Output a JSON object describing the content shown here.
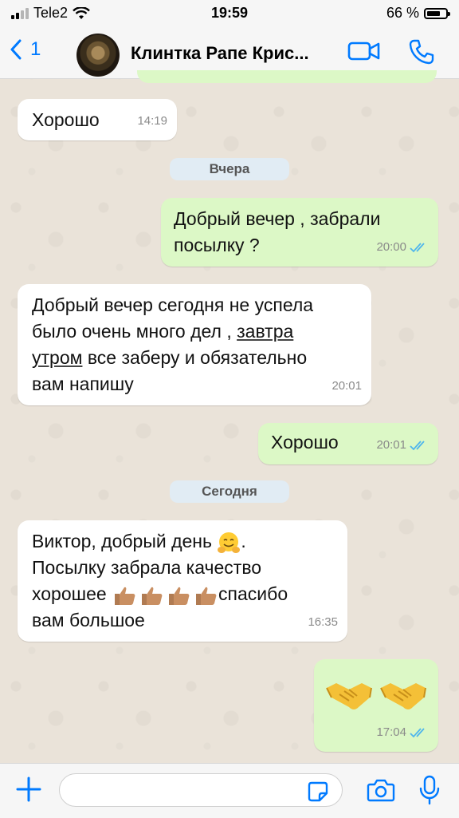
{
  "status_bar": {
    "carrier": "Tele2",
    "time": "19:59",
    "battery": "66 %"
  },
  "header": {
    "back_count": "1",
    "contact_name": "Клинтка Рапе Крис..."
  },
  "messages": [
    {
      "direction": "in",
      "text": "Хорошо",
      "time": "14:19"
    },
    {
      "date_label": "Вчера"
    },
    {
      "direction": "out",
      "lines": [
        "Добрый вечер , забрали",
        "посылку ?"
      ],
      "time": "20:00",
      "read": true
    },
    {
      "direction": "in",
      "lines": [
        "Добрый вечер сегодня не успела",
        "было очень много дел , ",
        "завтра",
        "утром",
        " все заберу и обязательно",
        "вам напишу"
      ],
      "time": "20:01"
    },
    {
      "direction": "out",
      "text": "Хорошо",
      "time": "20:01",
      "read": true
    },
    {
      "date_label": "Сегодня"
    },
    {
      "direction": "in",
      "lines": [
        "Виктор, добрый день",
        ".",
        "Посылку забрала качество",
        "хорошее",
        "спасибо",
        "вам большое"
      ],
      "time": "16:35"
    },
    {
      "direction": "out",
      "emoji": "handshake x2",
      "time": "17:04",
      "read": true
    }
  ],
  "input": {
    "value": "",
    "placeholder": ""
  },
  "colors": {
    "accent": "#007AFF",
    "outgoing": "#DCF8C6",
    "incoming": "#FFFFFF",
    "read_ticks": "#4FB6EC"
  }
}
